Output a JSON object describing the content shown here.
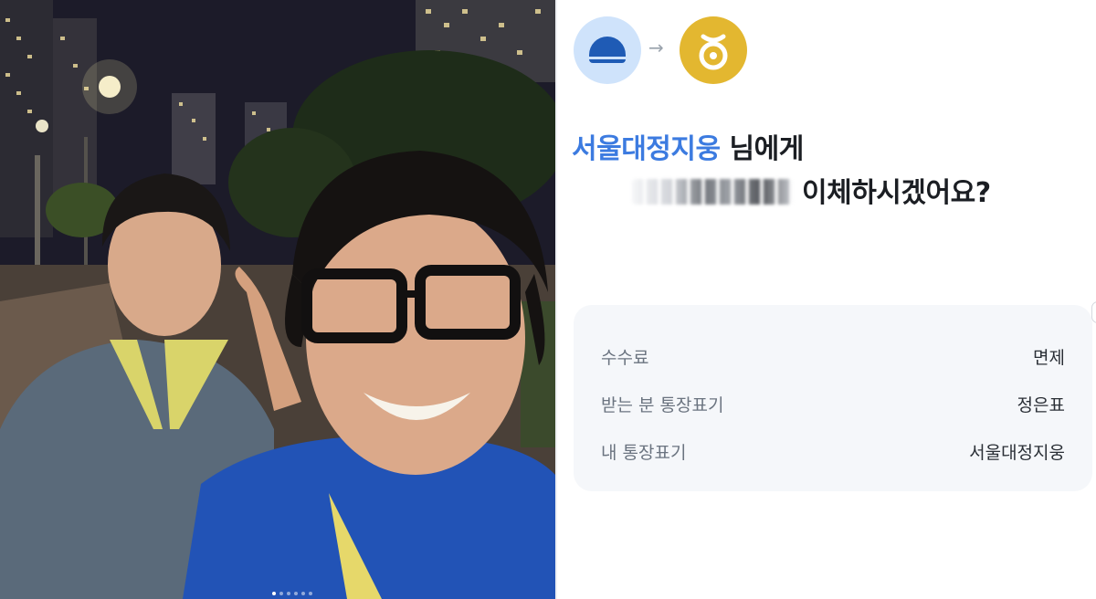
{
  "photo": {
    "description_icon": "selfie-photo",
    "carousel": {
      "count": 6,
      "active_index": 0
    }
  },
  "transfer": {
    "from_bank_icon": "bank-dome-logo-icon",
    "arrow_icon": "→",
    "to_bank_icon": "bank-coin-logo-icon",
    "recipient_name": "서울대정지웅",
    "recipient_suffix": " 님에게",
    "question": "이체하시겠어요?",
    "amount_masked": true,
    "accent_color": "#3c7be0",
    "details": [
      {
        "label": "수수료",
        "value": "면제"
      },
      {
        "label": "받는 분 통장표기",
        "value": "정은표"
      },
      {
        "label": "내 통장표기",
        "value": "서울대정지웅"
      }
    ]
  }
}
